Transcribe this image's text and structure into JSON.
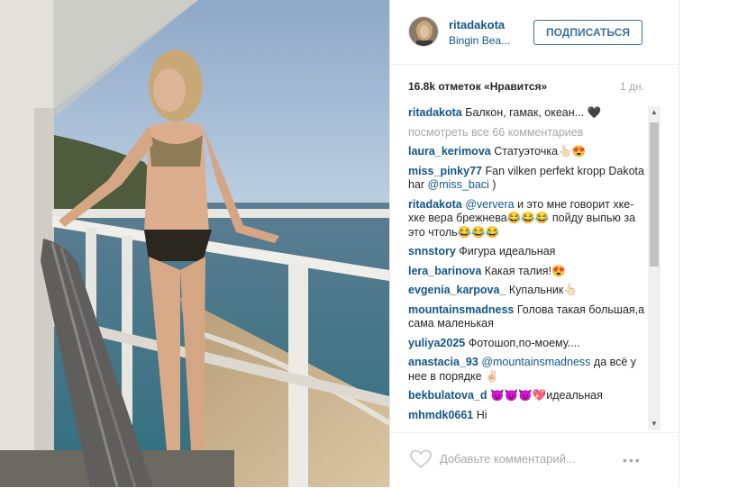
{
  "post": {
    "username": "ritadakota",
    "location": "Bingin Bea...",
    "follow_label": "ПОДПИСАТЬСЯ",
    "likes": "16.8k отметок «Нравится»",
    "time": "1 дн."
  },
  "comments": {
    "view_all": "посмотреть все 66 комментариев",
    "items": [
      {
        "user": "ritadakota",
        "text": "Балкон, гамак, океан... 🖤"
      },
      {
        "user": "laura_kerimova",
        "text": "Статуэточка👆🏻😍"
      },
      {
        "user": "miss_pinky77",
        "text": "Fan vilken perfekt kropp Dakota har ",
        "mention": "@miss_baci",
        "tail": ")"
      },
      {
        "user": "ritadakota",
        "mention": "@ververa",
        "text": " и это мне говорит хке-хке вера брежнева😂😂😂 пойду выпью за это чтоль😂😂😂"
      },
      {
        "user": "snnstory",
        "text": "Фигура идеальная"
      },
      {
        "user": "lera_barinova",
        "text": "Какая талия!😍"
      },
      {
        "user": "evgenia_karpova_",
        "text": "Купальник👆🏻"
      },
      {
        "user": "mountainsmadness",
        "text": "Голова такая большая,а сама маленькая"
      },
      {
        "user": "yuliya2025",
        "text": "Фотошоп,по-моему...."
      },
      {
        "user": "anastacia_93",
        "mention": "@mountainsmadness",
        "text": " да всё у нее в порядке ✌🏻"
      },
      {
        "user": "bekbulatova_d",
        "text": "😈😈😈💖идеальная"
      },
      {
        "user": "mhmdk0661",
        "text": "Hi"
      }
    ]
  },
  "footer": {
    "placeholder": "Добавьте комментарий...",
    "more": "•••"
  },
  "icons": {
    "like": "heart-icon",
    "more": "more-options-icon",
    "scroll_up": "scroll-up-icon",
    "scroll_down": "scroll-down-icon"
  },
  "colors": {
    "link": "#125688",
    "button": "#3f729b",
    "muted": "#a5a7aa"
  }
}
